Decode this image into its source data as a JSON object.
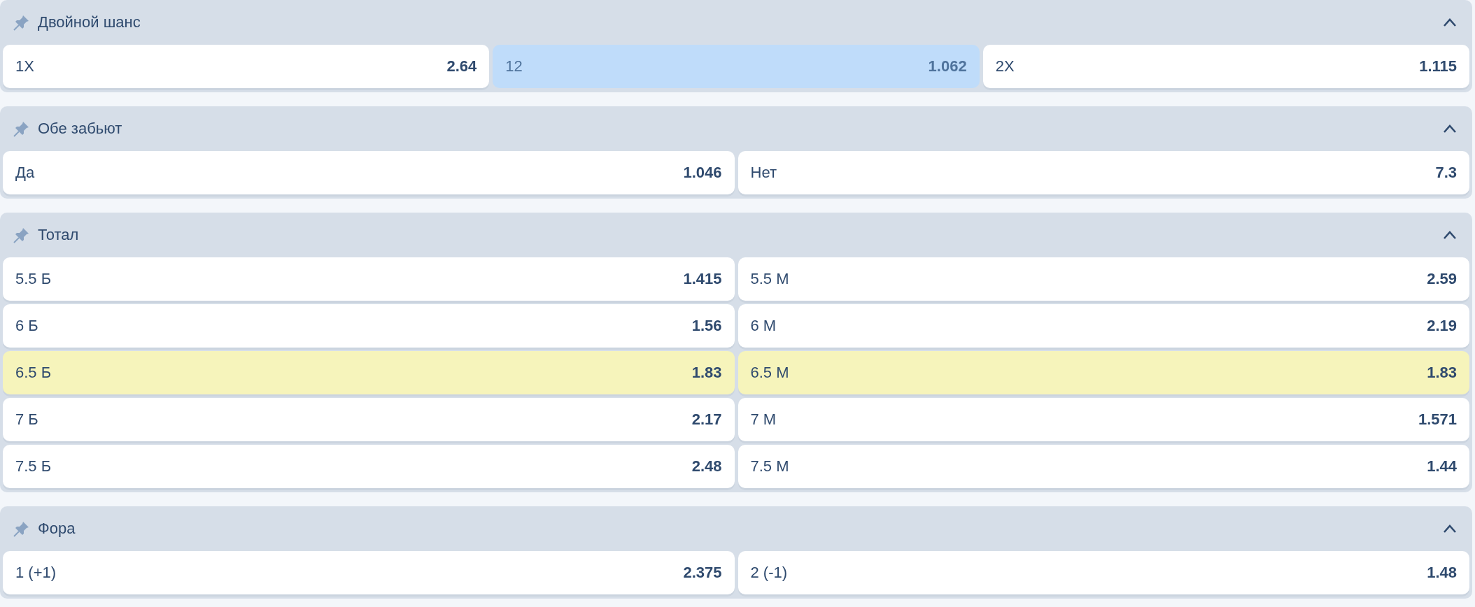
{
  "markets": [
    {
      "title": "Двойной шанс",
      "expanded": true,
      "rows": [
        [
          {
            "label": "1X",
            "odds": "2.64",
            "selected": false,
            "highlighted": false
          },
          {
            "label": "12",
            "odds": "1.062",
            "selected": true,
            "highlighted": false
          },
          {
            "label": "2X",
            "odds": "1.115",
            "selected": false,
            "highlighted": false
          }
        ]
      ]
    },
    {
      "title": "Обе забьют",
      "expanded": true,
      "rows": [
        [
          {
            "label": "Да",
            "odds": "1.046",
            "selected": false,
            "highlighted": false
          },
          {
            "label": "Нет",
            "odds": "7.3",
            "selected": false,
            "highlighted": false
          }
        ]
      ]
    },
    {
      "title": "Тотал",
      "expanded": true,
      "rows": [
        [
          {
            "label": "5.5 Б",
            "odds": "1.415",
            "selected": false,
            "highlighted": false
          },
          {
            "label": "5.5 М",
            "odds": "2.59",
            "selected": false,
            "highlighted": false
          }
        ],
        [
          {
            "label": "6 Б",
            "odds": "1.56",
            "selected": false,
            "highlighted": false
          },
          {
            "label": "6 М",
            "odds": "2.19",
            "selected": false,
            "highlighted": false
          }
        ],
        [
          {
            "label": "6.5 Б",
            "odds": "1.83",
            "selected": false,
            "highlighted": true
          },
          {
            "label": "6.5 М",
            "odds": "1.83",
            "selected": false,
            "highlighted": true
          }
        ],
        [
          {
            "label": "7 Б",
            "odds": "2.17",
            "selected": false,
            "highlighted": false
          },
          {
            "label": "7 М",
            "odds": "1.571",
            "selected": false,
            "highlighted": false
          }
        ],
        [
          {
            "label": "7.5 Б",
            "odds": "2.48",
            "selected": false,
            "highlighted": false
          },
          {
            "label": "7.5 М",
            "odds": "1.44",
            "selected": false,
            "highlighted": false
          }
        ]
      ]
    },
    {
      "title": "Фора",
      "expanded": true,
      "rows": [
        [
          {
            "label": "1 (+1)",
            "odds": "2.375",
            "selected": false,
            "highlighted": false
          },
          {
            "label": "2 (-1)",
            "odds": "1.48",
            "selected": false,
            "highlighted": false
          }
        ]
      ]
    }
  ]
}
